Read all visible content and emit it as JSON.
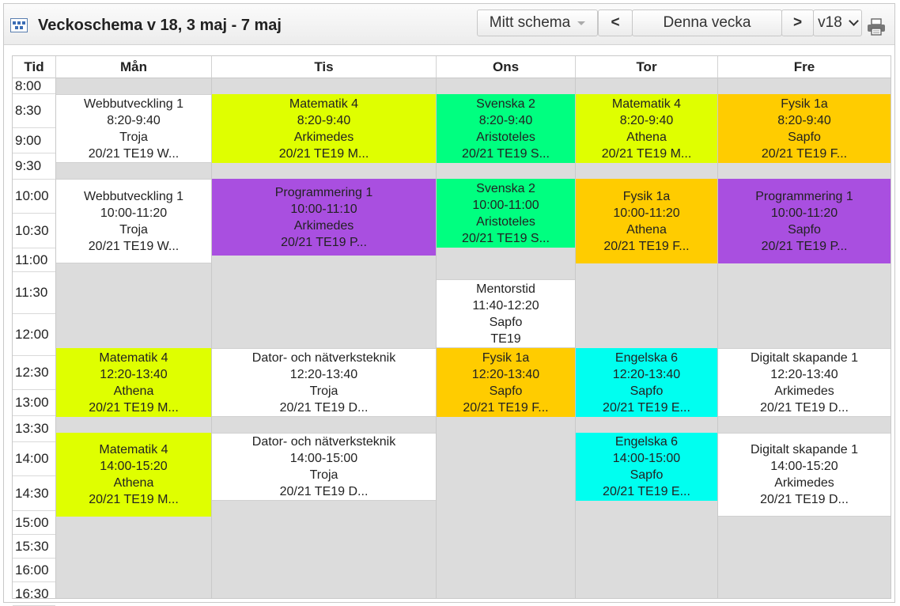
{
  "header": {
    "title": "Veckoschema v 18, 3 maj - 7 maj",
    "schedule_select": "Mitt schema",
    "prev_label": "<",
    "today_label": "Denna vecka",
    "next_label": ">",
    "week_select": "v18"
  },
  "columns": [
    "Tid",
    "Mån",
    "Tis",
    "Ons",
    "Tor",
    "Fre"
  ],
  "times": [
    "8:00",
    "8:30",
    "9:00",
    "9:30",
    "10:00",
    "10:30",
    "11:00",
    "11:30",
    "12:00",
    "12:30",
    "13:00",
    "13:30",
    "14:00",
    "14:30",
    "15:00",
    "15:30",
    "16:00",
    "16:30"
  ],
  "colors": {
    "lime": "#dfff00",
    "green": "#00ff80",
    "orange": "#ffcc00",
    "purple": "#a94fe0",
    "cyan": "#00fff0",
    "white": "#ffffff",
    "empty": "#dcdcdc"
  },
  "events": {
    "mon": [
      {
        "course": "Webbutveckling 1",
        "time": "8:20-9:40",
        "room": "Troja",
        "group": "20/21 TE19 W...",
        "color": "white"
      },
      {
        "course": "Webbutveckling 1",
        "time": "10:00-11:20",
        "room": "Troja",
        "group": "20/21 TE19 W...",
        "color": "white"
      },
      {
        "course": "Matematik 4",
        "time": "12:20-13:40",
        "room": "Athena",
        "group": "20/21 TE19 M...",
        "color": "lime"
      },
      {
        "course": "Matematik 4",
        "time": "14:00-15:20",
        "room": "Athena",
        "group": "20/21 TE19 M...",
        "color": "lime"
      }
    ],
    "tue": [
      {
        "course": "Matematik 4",
        "time": "8:20-9:40",
        "room": "Arkimedes",
        "group": "20/21 TE19 M...",
        "color": "lime"
      },
      {
        "course": "Programmering 1",
        "time": "10:00-11:10",
        "room": "Arkimedes",
        "group": "20/21 TE19 P...",
        "color": "purple"
      },
      {
        "course": "Dator- och nätverksteknik",
        "time": "12:20-13:40",
        "room": "Troja",
        "group": "20/21 TE19 D...",
        "color": "white"
      },
      {
        "course": "Dator- och nätverksteknik",
        "time": "14:00-15:00",
        "room": "Troja",
        "group": "20/21 TE19 D...",
        "color": "white"
      }
    ],
    "wed": [
      {
        "course": "Svenska 2",
        "time": "8:20-9:40",
        "room": "Aristoteles",
        "group": "20/21 TE19 S...",
        "color": "green"
      },
      {
        "course": "Svenska 2",
        "time": "10:00-11:00",
        "room": "Aristoteles",
        "group": "20/21 TE19 S...",
        "color": "green"
      },
      {
        "course": "Mentorstid",
        "time": "11:40-12:20",
        "room": "Sapfo",
        "group": "TE19",
        "color": "white"
      },
      {
        "course": "Fysik 1a",
        "time": "12:20-13:40",
        "room": "Sapfo",
        "group": "20/21 TE19 F...",
        "color": "orange"
      }
    ],
    "thu": [
      {
        "course": "Matematik 4",
        "time": "8:20-9:40",
        "room": "Athena",
        "group": "20/21 TE19 M...",
        "color": "lime"
      },
      {
        "course": "Fysik 1a",
        "time": "10:00-11:20",
        "room": "Athena",
        "group": "20/21 TE19 F...",
        "color": "orange"
      },
      {
        "course": "Engelska 6",
        "time": "12:20-13:40",
        "room": "Sapfo",
        "group": "20/21 TE19 E...",
        "color": "cyan"
      },
      {
        "course": "Engelska 6",
        "time": "14:00-15:00",
        "room": "Sapfo",
        "group": "20/21 TE19 E...",
        "color": "cyan"
      }
    ],
    "fri": [
      {
        "course": "Fysik 1a",
        "time": "8:20-9:40",
        "room": "Sapfo",
        "group": "20/21 TE19 F...",
        "color": "orange"
      },
      {
        "course": "Programmering 1",
        "time": "10:00-11:20",
        "room": "Sapfo",
        "group": "20/21 TE19 P...",
        "color": "purple"
      },
      {
        "course": "Digitalt skapande 1",
        "time": "12:20-13:40",
        "room": "Arkimedes",
        "group": "20/21 TE19 D...",
        "color": "white"
      },
      {
        "course": "Digitalt skapande 1",
        "time": "14:00-15:20",
        "room": "Arkimedes",
        "group": "20/21 TE19 D...",
        "color": "white"
      }
    ]
  }
}
